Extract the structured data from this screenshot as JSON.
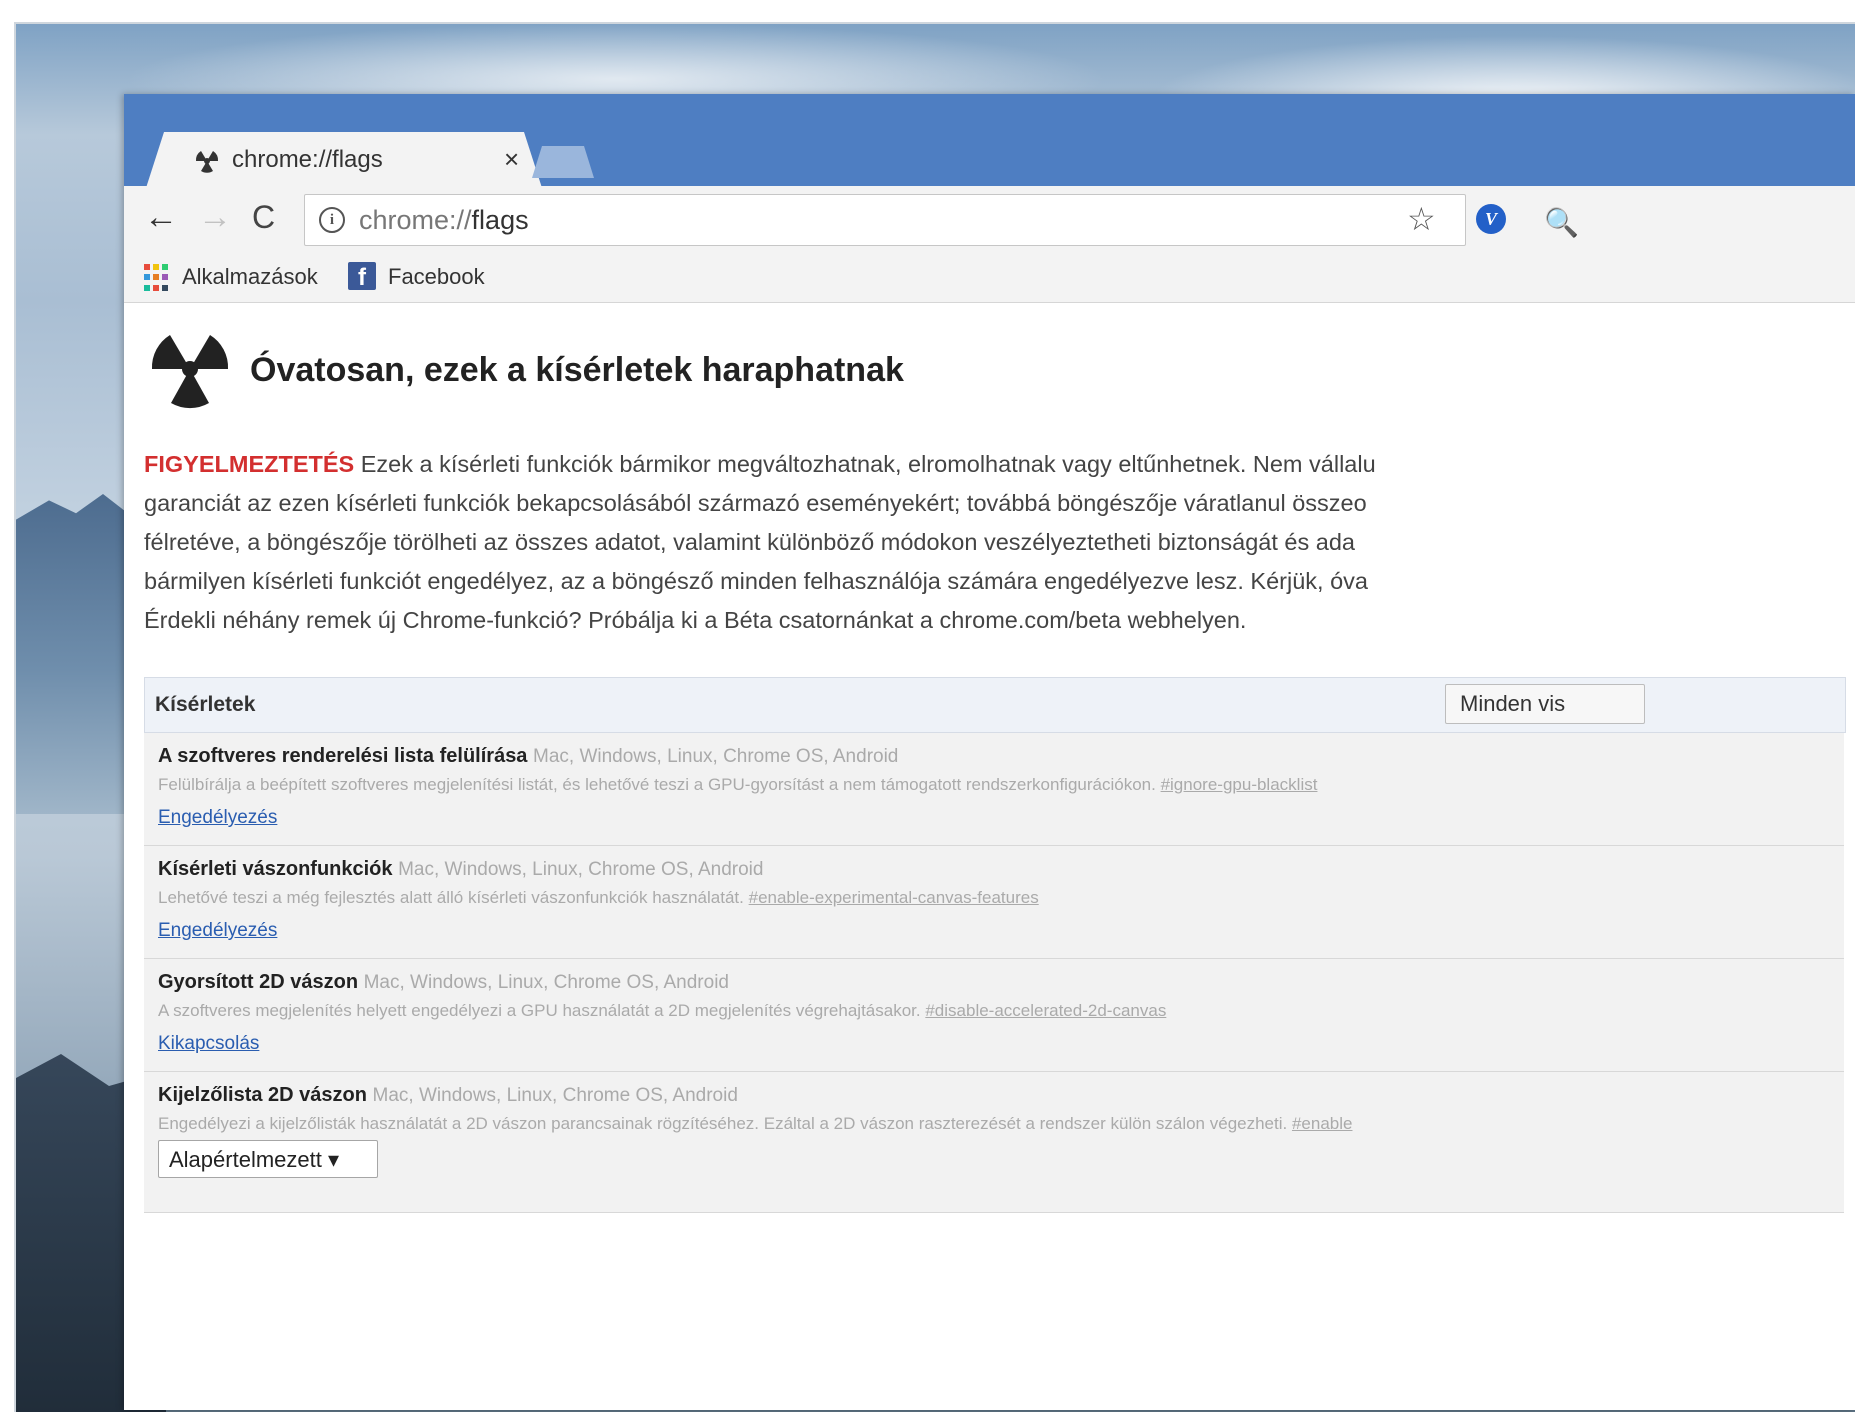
{
  "tab": {
    "title": "chrome://flags",
    "close": "×"
  },
  "toolbar": {
    "back": "←",
    "forward": "→",
    "reload": "C",
    "info": "i",
    "url_prefix": "chrome://",
    "url_path": "flags",
    "star": "☆",
    "ext_label": "V",
    "ext2": "🔍"
  },
  "bookmarks": [
    {
      "label": "Alkalmazások"
    },
    {
      "label": "Facebook",
      "icon_letter": "f"
    }
  ],
  "page": {
    "title": "Óvatosan, ezek a kísérletek haraphatnak",
    "warning_label": "FIGYELMEZTETÉS",
    "warning_lines": [
      " Ezek a kísérleti funkciók bármikor megváltozhatnak, elromolhatnak vagy eltűnhetnek. Nem vállalu",
      "garanciát az ezen kísérleti funkciók bekapcsolásából származó eseményekért; továbbá böngészője váratlanul összeo",
      "félretéve, a böngészője törölheti az összes adatot, valamint különböző módokon veszélyeztetheti biztonságát és ada",
      "bármilyen kísérleti funkciót engedélyez, az a böngésző minden felhasználója számára engedélyezve lesz. Kérjük, óva",
      "Érdekli néhány remek új Chrome-funkció? Próbálja ki a Béta csatornánkat a chrome.com/beta webhelyen."
    ]
  },
  "experiments": {
    "header": "Kísérletek",
    "reset_label": "Minden vis",
    "items": [
      {
        "name": "A szoftveres renderelési lista felülírása",
        "platforms": "Mac, Windows, Linux, Chrome OS, Android",
        "description": "Felülbírálja a beépített szoftveres megjelenítési listát, és lehetővé teszi a GPU-gyorsítást a nem támogatott rendszerkonfigurációkon.",
        "hash": "#ignore-gpu-blacklist",
        "action": "Engedélyezés"
      },
      {
        "name": "Kísérleti vászonfunkciók",
        "platforms": "Mac, Windows, Linux, Chrome OS, Android",
        "description": "Lehetővé teszi a még fejlesztés alatt álló kísérleti vászonfunkciók használatát.",
        "hash": "#enable-experimental-canvas-features",
        "action": "Engedélyezés"
      },
      {
        "name": "Gyorsított 2D vászon",
        "platforms": "Mac, Windows, Linux, Chrome OS, Android",
        "description": "A szoftveres megjelenítés helyett engedélyezi a GPU használatát a 2D megjelenítés végrehajtásakor.",
        "hash": "#disable-accelerated-2d-canvas",
        "action": "Kikapcsolás"
      },
      {
        "name": "Kijelzőlista 2D vászon",
        "platforms": "Mac, Windows, Linux, Chrome OS, Android",
        "description": "Engedélyezi a kijelzőlisták használatát a 2D vászon parancsainak rögzítéséhez. Ezáltal a 2D vászon raszterezését a rendszer külön szálon végezheti.",
        "hash": "#enable",
        "select_value": "Alapértelmezett ▾"
      }
    ]
  },
  "colors": {
    "titlebar": "#4e7ec2",
    "warning": "#d32f2f",
    "link": "#2a5db0"
  }
}
